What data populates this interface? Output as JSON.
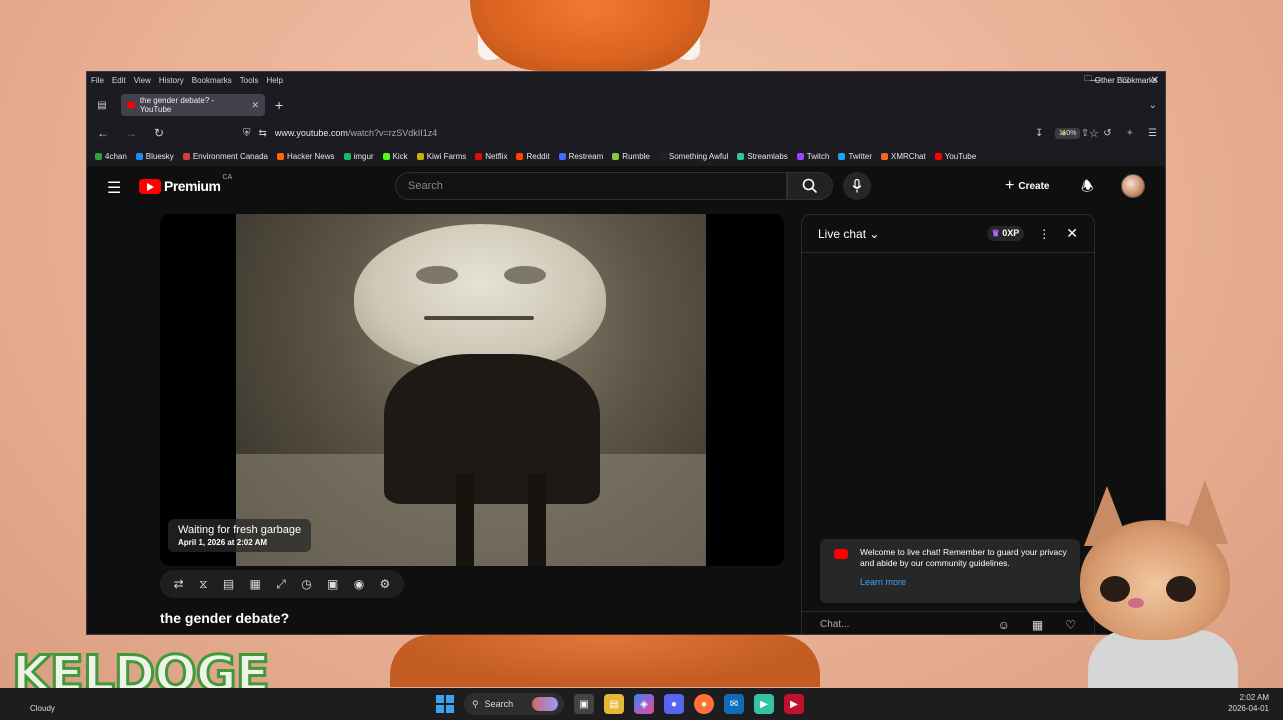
{
  "browser": {
    "menu": [
      "File",
      "Edit",
      "View",
      "History",
      "Bookmarks",
      "Tools",
      "Help"
    ],
    "tab_title": "the gender debate? - YouTube",
    "url_domain": "www.youtube.com",
    "url_path": "/watch?v=rzSVdkII1z4",
    "zoom": "110%",
    "bookmarks": [
      {
        "label": "4chan",
        "color": "#2f9e44"
      },
      {
        "label": "Bluesky",
        "color": "#1d8cf0"
      },
      {
        "label": "Environment Canada",
        "color": "#d63c3c"
      },
      {
        "label": "Hacker News",
        "color": "#ff6600"
      },
      {
        "label": "imgur",
        "color": "#1bb76e"
      },
      {
        "label": "Kick",
        "color": "#53fc18"
      },
      {
        "label": "Kiwi Farms",
        "color": "#c8b400"
      },
      {
        "label": "Netflix",
        "color": "#e50914"
      },
      {
        "label": "Reddit",
        "color": "#ff4500"
      },
      {
        "label": "Restream",
        "color": "#3b6bff"
      },
      {
        "label": "Rumble",
        "color": "#85c742"
      },
      {
        "label": "Something Awful",
        "color": "#222222"
      },
      {
        "label": "Streamlabs",
        "color": "#31c3a2"
      },
      {
        "label": "Twitch",
        "color": "#9146ff"
      },
      {
        "label": "Twitter",
        "color": "#1da1f2"
      },
      {
        "label": "XMRChat",
        "color": "#f26822"
      },
      {
        "label": "YouTube",
        "color": "#ff0000"
      }
    ],
    "other_bookmarks": "Other Bookmarks"
  },
  "youtube": {
    "logo_text": "Premium",
    "region": "CA",
    "search_placeholder": "Search",
    "create_label": "Create",
    "player": {
      "overlay_title": "Waiting for fresh garbage",
      "overlay_date": "April 1, 2026 at 2:02 AM"
    },
    "video_title": "the gender debate?",
    "chat": {
      "title": "Live chat",
      "xp": "0XP",
      "welcome": "Welcome to live chat! Remember to guard your privacy and abide by our community guidelines.",
      "learn_more": "Learn more",
      "input_placeholder": "Chat..."
    }
  },
  "overlay": {
    "streamer_name": "KELDOGE"
  },
  "taskbar": {
    "weather": "Cloudy",
    "search_label": "Search",
    "time": "2:02 AM",
    "date": "2026-04-01"
  }
}
